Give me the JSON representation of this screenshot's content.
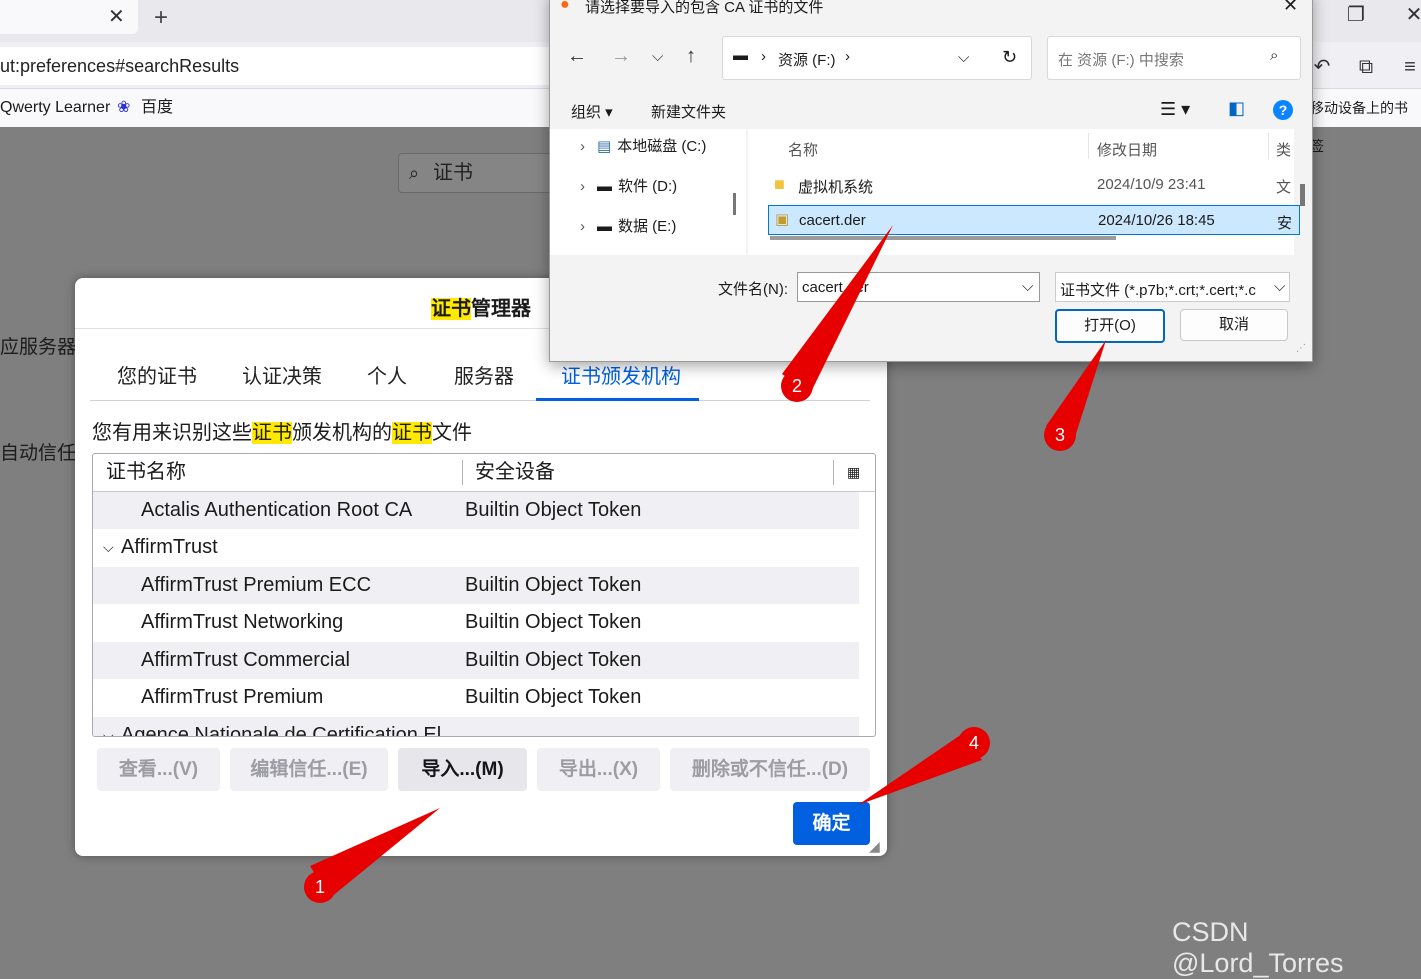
{
  "browser": {
    "new_tab_label": "+",
    "url": "ut:preferences#searchResults",
    "bookmarks": [
      "Qwerty Learner",
      "百度"
    ],
    "mobile_bookmarks": "移动设备上的书签"
  },
  "page": {
    "search_value": "证书",
    "bg_text_1": "应服务器",
    "bg_text_2": "自动信任"
  },
  "cert_manager": {
    "title_hl": "证书",
    "title_rest": "管理器",
    "tabs": [
      "您的证书",
      "认证决策",
      "个人",
      "服务器",
      "证书颁发机构"
    ],
    "desc_1": "您有用来识别这些",
    "desc_hl1": "证书",
    "desc_2": "颁发机构的",
    "desc_hl2": "证书",
    "desc_3": "文件",
    "columns": [
      "证书名称",
      "安全设备"
    ],
    "rows": [
      {
        "name": "Actalis Authentication Root CA",
        "device": "Builtin Object Token"
      },
      {
        "group": "AffirmTrust"
      },
      {
        "name": "AffirmTrust Premium ECC",
        "device": "Builtin Object Token"
      },
      {
        "name": "AffirmTrust Networking",
        "device": "Builtin Object Token"
      },
      {
        "name": "AffirmTrust Commercial",
        "device": "Builtin Object Token"
      },
      {
        "name": "AffirmTrust Premium",
        "device": "Builtin Object Token"
      },
      {
        "group": "Agence Nationale de Certification El"
      }
    ],
    "buttons": {
      "view": "查看...(V)",
      "edit": "编辑信任...(E)",
      "import": "导入...(M)",
      "export": "导出...(X)",
      "delete": "删除或不信任...(D)",
      "ok": "确定"
    }
  },
  "file_dialog": {
    "title": "请选择要导入的包含 CA 证书的文件",
    "breadcrumb": "资源 (F:)",
    "search_placeholder": "在 资源 (F:) 中搜索",
    "organize": "组织",
    "new_folder": "新建文件夹",
    "tree": [
      "本地磁盘 (C:)",
      "软件 (D:)",
      "数据 (E:)"
    ],
    "columns": {
      "name": "名称",
      "date": "修改日期",
      "type": "类"
    },
    "files": [
      {
        "name": "虚拟机系统",
        "date": "2024/10/9 23:41",
        "type": "文"
      },
      {
        "name": "cacert.der",
        "date": "2024/10/26 18:45",
        "type": "安"
      }
    ],
    "filename_label": "文件名(N):",
    "filename_value": "cacert.der",
    "filetype": "证书文件 (*.p7b;*.crt;*.cert;*.c",
    "open": "打开(O)",
    "cancel": "取消"
  },
  "annotations": [
    "1",
    "2",
    "3",
    "4"
  ],
  "watermark": "CSDN @Lord_Torres",
  "colors": {
    "accent": "#0060df",
    "highlight": "#ffe900",
    "annotation": "#e60000",
    "selected_row": "#cce8ff"
  }
}
